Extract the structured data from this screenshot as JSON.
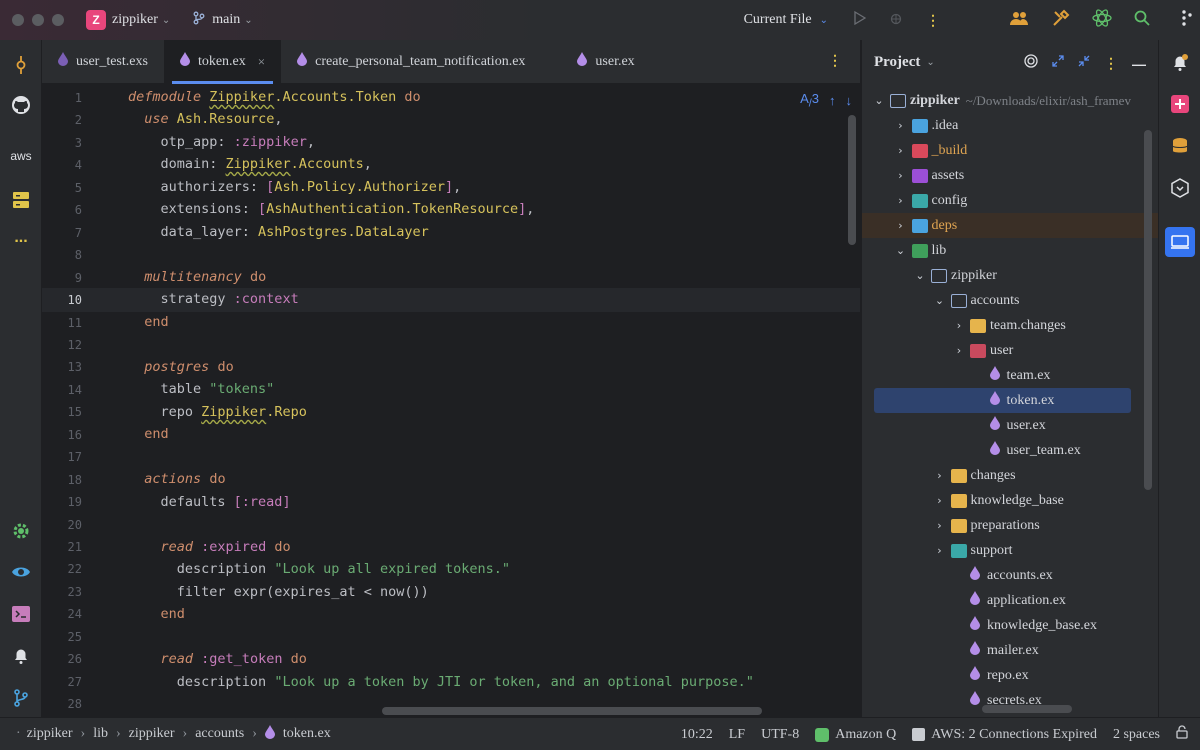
{
  "titlebar": {
    "project_badge": "Z",
    "project_name": "zippiker",
    "branch": "main",
    "run_config": "Current File"
  },
  "tabs": [
    {
      "label": "user_test.exs",
      "icon": "elixir-drop-icon",
      "color": "#7b5fb5"
    },
    {
      "label": "token.ex",
      "icon": "elixir-drop-icon",
      "color": "#b48ee8",
      "active": true,
      "close": "×"
    },
    {
      "label": "create_personal_team_notification.ex",
      "icon": "elixir-drop-icon",
      "color": "#b48ee8"
    },
    {
      "label": "user.ex",
      "icon": "elixir-drop-icon",
      "color": "#b48ee8"
    }
  ],
  "editor": {
    "inspection_count": "3",
    "current_line": "10",
    "line_numbers": [
      "1",
      "2",
      "3",
      "4",
      "5",
      "6",
      "7",
      "8",
      "9",
      "10",
      "11",
      "12",
      "13",
      "14",
      "15",
      "16",
      "17",
      "18",
      "19",
      "20",
      "21",
      "22",
      "23",
      "24",
      "25",
      "26",
      "27",
      "28"
    ]
  },
  "project": {
    "title": "Project",
    "root_name": "zippiker",
    "root_path": "~/Downloads/elixir/ash_framev",
    "items": [
      {
        "label": ".idea",
        "type": "folder",
        "depth": 1,
        "arrow": ">",
        "color": "#4aa3df"
      },
      {
        "label": "_build",
        "type": "folder",
        "depth": 1,
        "arrow": ">",
        "color": "#d9495b",
        "text_color": "#e0a552"
      },
      {
        "label": "assets",
        "type": "folder",
        "depth": 1,
        "arrow": ">",
        "color": "#9c4fd6"
      },
      {
        "label": "config",
        "type": "folder",
        "depth": 1,
        "arrow": ">",
        "color": "#3aa8a8"
      },
      {
        "label": "deps",
        "type": "folder",
        "depth": 1,
        "arrow": ">",
        "color": "#4aa3df",
        "text_color": "#e0a552",
        "highlight": true
      },
      {
        "label": "lib",
        "type": "folder",
        "depth": 1,
        "arrow": "v",
        "color": "#3f9f5b"
      },
      {
        "label": "zippiker",
        "type": "folder",
        "depth": 2,
        "arrow": "v",
        "color": "plain"
      },
      {
        "label": "accounts",
        "type": "folder",
        "depth": 3,
        "arrow": "v",
        "color": "plain"
      },
      {
        "label": "team.changes",
        "type": "folder",
        "depth": 4,
        "arrow": ">",
        "color": "#e6b44c"
      },
      {
        "label": "user",
        "type": "folder",
        "depth": 4,
        "arrow": ">",
        "color": "#c94a5e"
      },
      {
        "label": "team.ex",
        "type": "file",
        "depth": 5
      },
      {
        "label": "token.ex",
        "type": "file",
        "depth": 5,
        "selected": true
      },
      {
        "label": "user.ex",
        "type": "file",
        "depth": 5
      },
      {
        "label": "user_team.ex",
        "type": "file",
        "depth": 5
      },
      {
        "label": "changes",
        "type": "folder",
        "depth": 3,
        "arrow": ">",
        "color": "#e6b44c"
      },
      {
        "label": "knowledge_base",
        "type": "folder",
        "depth": 3,
        "arrow": ">",
        "color": "#e6b44c"
      },
      {
        "label": "preparations",
        "type": "folder",
        "depth": 3,
        "arrow": ">",
        "color": "#e6b44c"
      },
      {
        "label": "support",
        "type": "folder",
        "depth": 3,
        "arrow": ">",
        "color": "#3aa8a8"
      },
      {
        "label": "accounts.ex",
        "type": "file",
        "depth": 4
      },
      {
        "label": "application.ex",
        "type": "file",
        "depth": 4
      },
      {
        "label": "knowledge_base.ex",
        "type": "file",
        "depth": 4
      },
      {
        "label": "mailer.ex",
        "type": "file",
        "depth": 4
      },
      {
        "label": "repo.ex",
        "type": "file",
        "depth": 4
      },
      {
        "label": "secrets.ex",
        "type": "file",
        "depth": 4
      }
    ]
  },
  "left_strip": {
    "aws_label": "aws",
    "more_label": "..."
  },
  "statusbar": {
    "breadcrumb": [
      "zippiker",
      "lib",
      "zippiker",
      "accounts",
      "token.ex"
    ],
    "position": "10:22",
    "line_ending": "LF",
    "encoding": "UTF-8",
    "amazon_q": "Amazon Q",
    "aws_status": "AWS: 2 Connections Expired",
    "indent": "2 spaces"
  },
  "colors": {
    "accent": "#5b8def",
    "keyword": "#cf8e6d",
    "module": "#d6c25c",
    "string": "#6aab73",
    "atom": "#c77dbb"
  }
}
